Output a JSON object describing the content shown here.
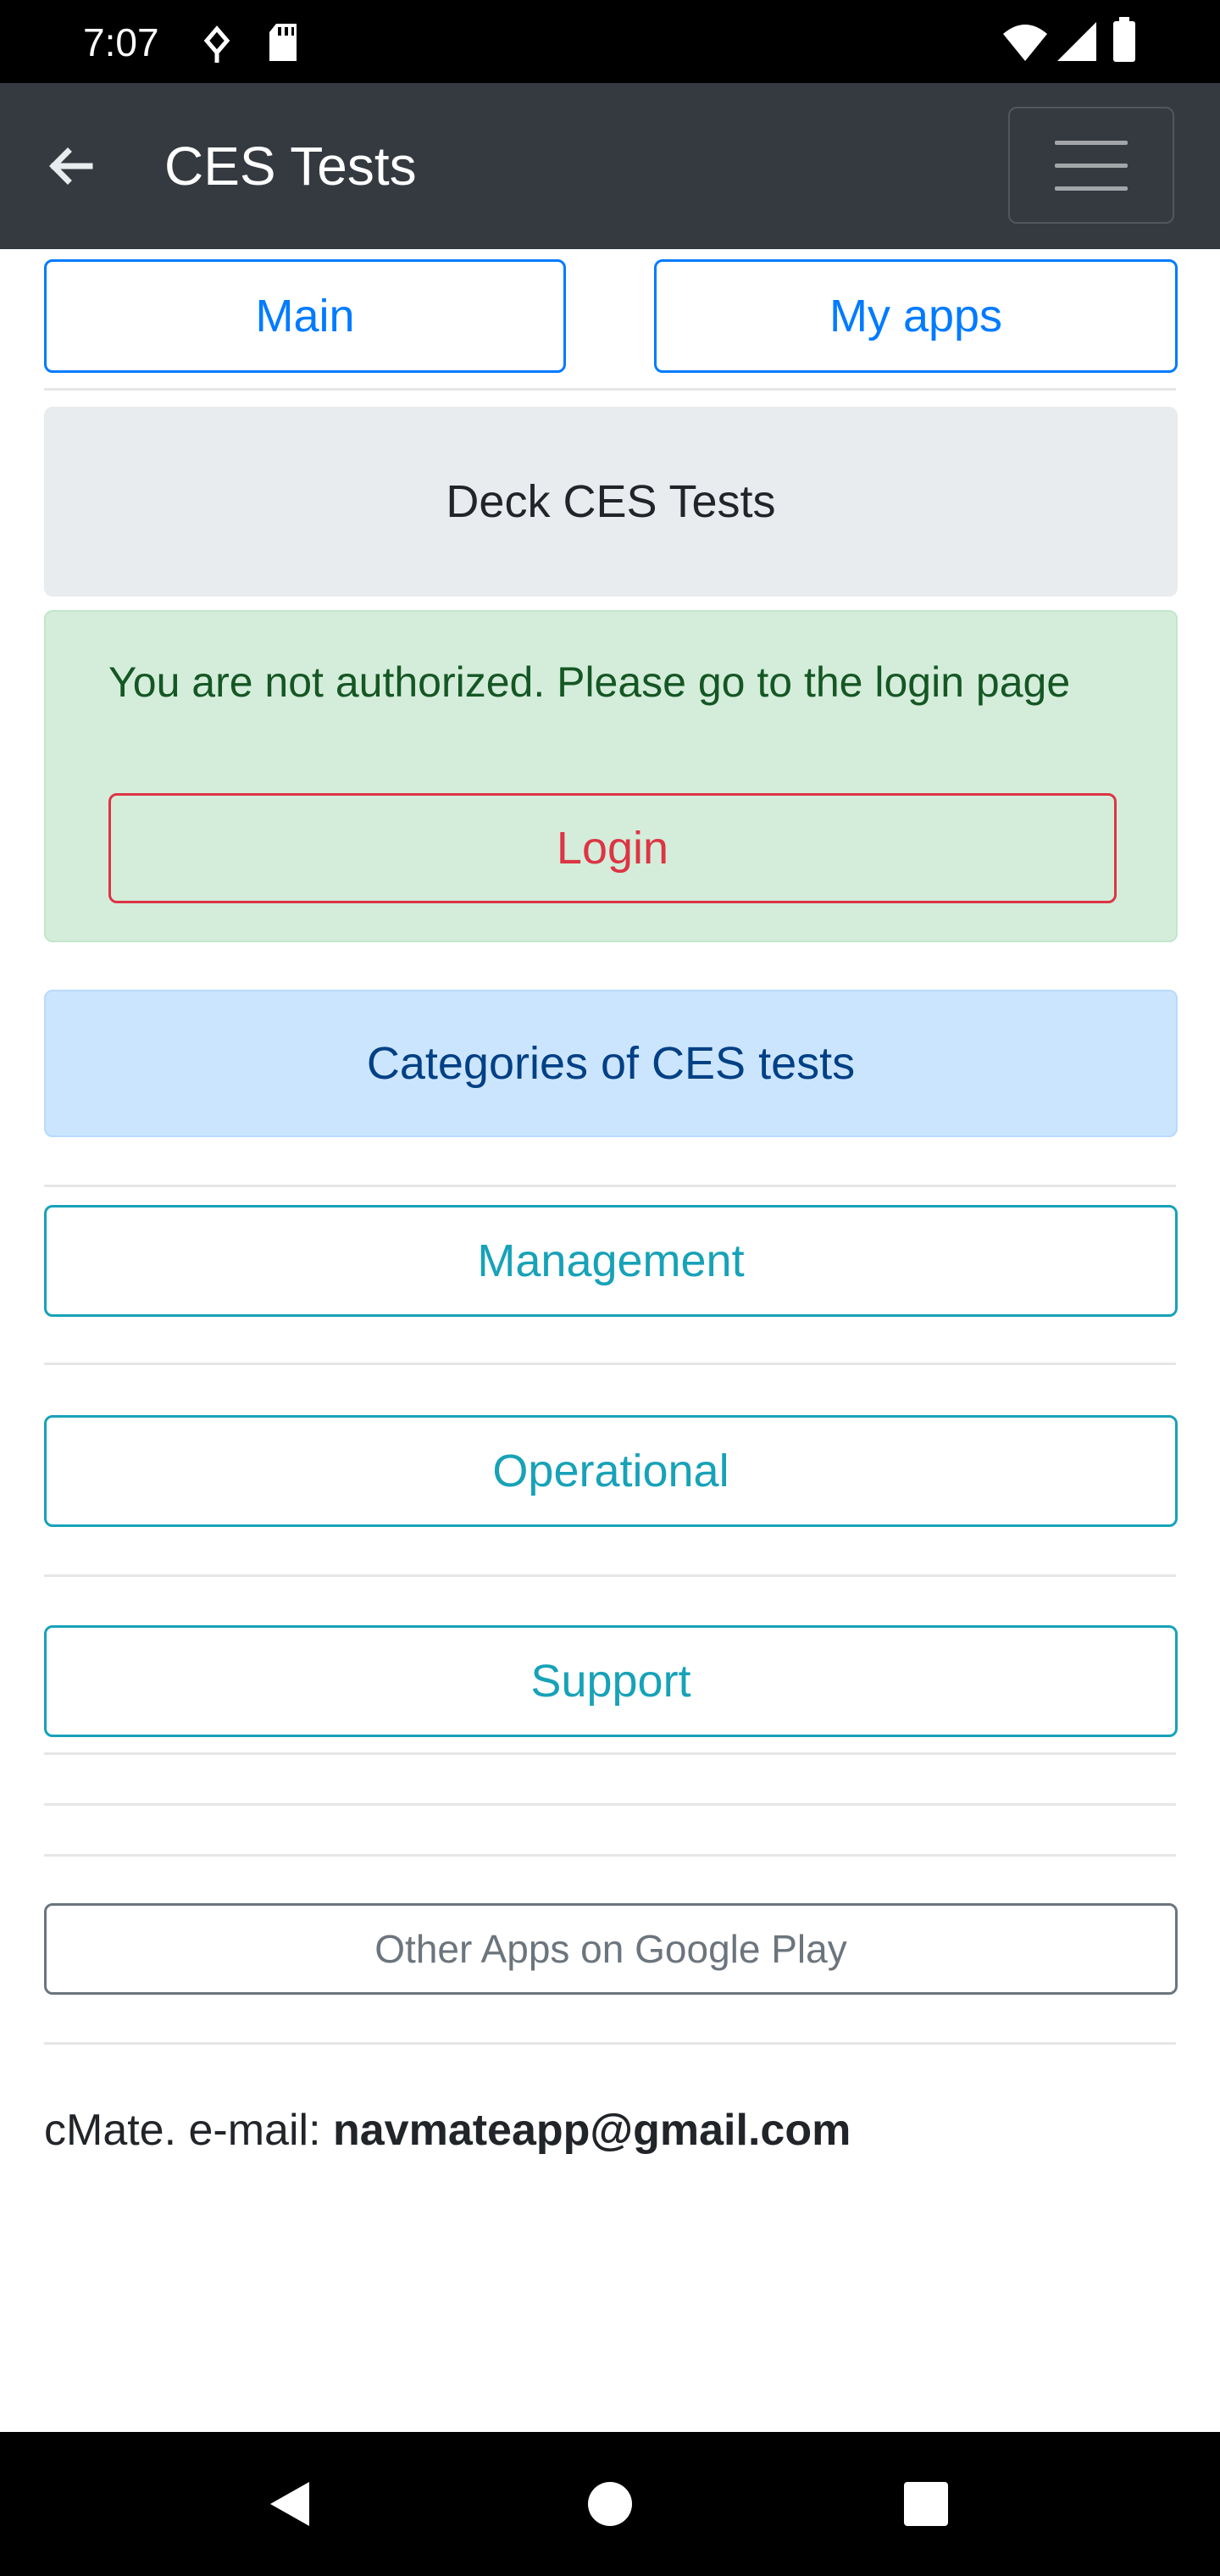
{
  "status_bar": {
    "time": "7:07",
    "icons": [
      "data-saver-icon",
      "sd-card-icon",
      "wifi-icon",
      "signal-icon",
      "battery-icon"
    ]
  },
  "app_bar": {
    "title": "CES Tests",
    "back_icon": "arrow-back-icon",
    "menu_icon": "hamburger-menu-icon"
  },
  "top_nav": {
    "main_label": "Main",
    "my_apps_label": "My apps"
  },
  "deck_card": {
    "title": "Deck CES Tests"
  },
  "auth_alert": {
    "message": "You are not authorized. Please go to the login page",
    "login_label": "Login"
  },
  "categories": {
    "heading": "Categories of CES tests",
    "items": [
      {
        "label": "Management"
      },
      {
        "label": "Operational"
      },
      {
        "label": "Support"
      }
    ]
  },
  "other_apps": {
    "label": "Other Apps on Google Play"
  },
  "footer": {
    "prefix": "cMate. e-mail: ",
    "email": "navmateapp@gmail.com"
  },
  "colors": {
    "app_bar": "#343a40",
    "primary": "#007bff",
    "danger": "#dc3545",
    "info": "#17a2b8",
    "secondary": "#6c757d",
    "success_bg": "#d4edda",
    "primary_bg": "#cce5ff"
  }
}
